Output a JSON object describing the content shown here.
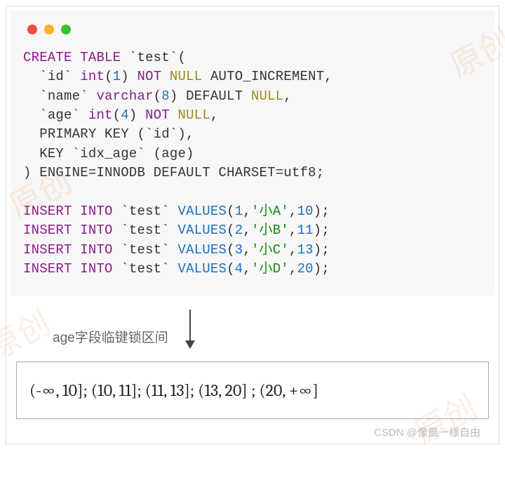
{
  "colors": {
    "traffic_red": "#ec4d3e",
    "traffic_yellow": "#f5b22a",
    "traffic_green": "#35c131",
    "keyword": "#8b1d8b",
    "number": "#1c6fbb",
    "null": "#9a8a1c",
    "string": "#138a13"
  },
  "code": {
    "l1": {
      "create": "CREATE",
      "table": "TABLE",
      "name": "`test`",
      "open": "("
    },
    "l2": {
      "col": "`id`",
      "type": "int",
      "size": "1",
      "not": "NOT",
      "null": "NULL",
      "extra": "AUTO_INCREMENT,"
    },
    "l3": {
      "col": "`name`",
      "type": "varchar",
      "size": "8",
      "deflt": "DEFAULT",
      "null": "NULL",
      "trail": ","
    },
    "l4": {
      "col": "`age`",
      "type": "int",
      "size": "4",
      "not": "NOT",
      "null": "NULL",
      "trail": ","
    },
    "l5": {
      "pk1": "PRIMARY",
      "pk2": "KEY",
      "cols": "(`id`),"
    },
    "l6": {
      "key": "KEY",
      "name": "`idx_age`",
      "cols": "(age)"
    },
    "l7": {
      "close": ")",
      "eng": "ENGINE",
      "eq1": "=",
      "innodb": "INNODB",
      "deflt": "DEFAULT",
      "cs": "CHARSET",
      "eq2": "=",
      "utf": "utf8;"
    },
    "ins1": {
      "insert": "INSERT",
      "into": "INTO",
      "tbl": "`test`",
      "vals": "VALUES",
      "open": "(",
      "v1": "1",
      "c1": ",",
      "s": "'小A'",
      "c2": ",",
      "v2": "10",
      "close": ");"
    },
    "ins2": {
      "insert": "INSERT",
      "into": "INTO",
      "tbl": "`test`",
      "vals": "VALUES",
      "open": "(",
      "v1": "2",
      "c1": ",",
      "s": "'小B'",
      "c2": ",",
      "v2": "11",
      "close": ");"
    },
    "ins3": {
      "insert": "INSERT",
      "into": "INTO",
      "tbl": "`test`",
      "vals": "VALUES",
      "open": "(",
      "v1": "3",
      "c1": ",",
      "s": "'小C'",
      "c2": ",",
      "v2": "13",
      "close": ");"
    },
    "ins4": {
      "insert": "INSERT",
      "into": "INTO",
      "tbl": "`test`",
      "vals": "VALUES",
      "open": "(",
      "v1": "4",
      "c1": ",",
      "s": "'小D'",
      "c2": ",",
      "v2": "20",
      "close": ");"
    }
  },
  "arrow_label": "age字段临键锁区间",
  "intervals_text": "(-∞, 10];  (10, 11];  (11, 13];  (13, 20] ;  (20, +∞]",
  "intervals": [
    {
      "low": "-∞",
      "high": 10
    },
    {
      "low": 10,
      "high": 11
    },
    {
      "low": 11,
      "high": 13
    },
    {
      "low": 13,
      "high": 20
    },
    {
      "low": 20,
      "high": "+∞"
    }
  ],
  "watermark_footer": "CSDN @像風一様自由",
  "diag_watermark": "原创"
}
